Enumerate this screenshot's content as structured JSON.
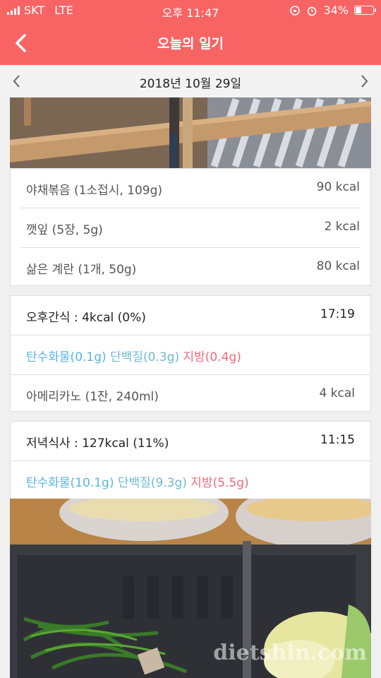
{
  "status": {
    "carrier": "SKT",
    "network": "LTE",
    "time": "오후 11:47",
    "battery": "34%"
  },
  "nav": {
    "title": "오늘의 일기"
  },
  "date": "2018년 10월 29일",
  "lunch_items": [
    {
      "name": "야채볶음 (1소접시, 109g)",
      "kcal": "90 kcal"
    },
    {
      "name": "깻잎 (5장, 5g)",
      "kcal": "2 kcal"
    },
    {
      "name": "삶은 계란 (1개, 50g)",
      "kcal": "80 kcal"
    }
  ],
  "snack": {
    "header": "오후간식 : 4kcal (0%)",
    "time": "17:19",
    "carb": "탄수화물(0.1g)",
    "protein": "단백질(0.3g)",
    "fat": "지방(0.4g)",
    "items": [
      {
        "name": "아메리카노 (1잔, 240ml)",
        "kcal": "4 kcal"
      }
    ]
  },
  "dinner": {
    "header": "저녁식사 : 127kcal (11%)",
    "time": "11:15",
    "carb": "탄수화물(10.1g)",
    "protein": "단백질(9.3g)",
    "fat": "지방(5.5g)"
  },
  "watermark": "dietshin.com",
  "colors": {
    "header": "#f86464",
    "carb": "#5ab4e0",
    "protein": "#6fb9d4",
    "fat": "#ef6a7c"
  },
  "icons": {
    "back": "chevron-left-icon",
    "prev": "chevron-left-icon",
    "next": "chevron-right-icon"
  }
}
